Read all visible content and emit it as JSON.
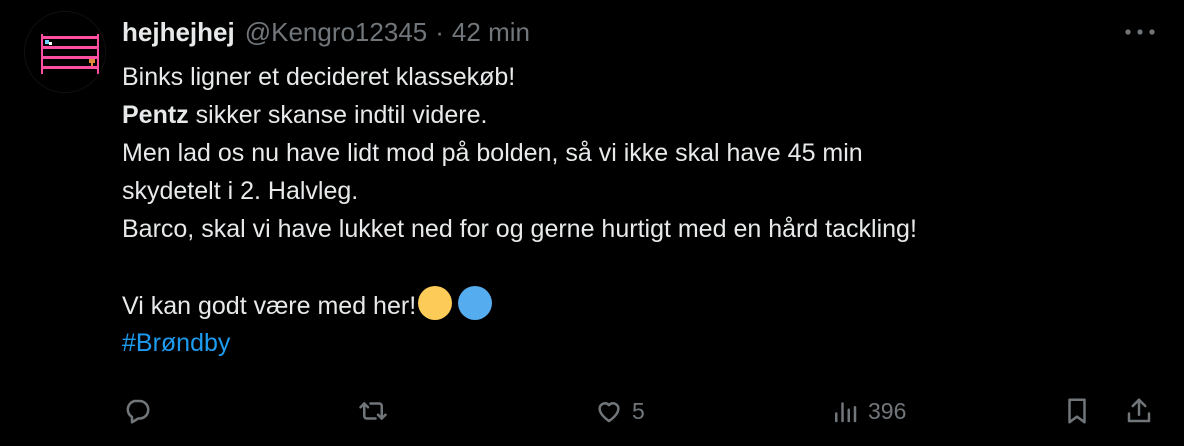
{
  "tweet": {
    "author": {
      "name": "hejhejhej",
      "handle": "@Kengro12345",
      "separator": "·",
      "time": "42 min"
    },
    "lines": [
      {
        "bold": "",
        "text": "Binks ligner et decideret klassekøb!"
      },
      {
        "bold": "Pentz",
        "text": " sikker skanse indtil videre."
      },
      {
        "bold": "",
        "text": "Men lad os nu have lidt mod på bolden, så vi ikke skal have 45 min"
      },
      {
        "bold": "",
        "text": "skydetelt i 2. Halvleg."
      },
      {
        "bold": "",
        "text": "Barco, skal vi have lukket ned for og gerne hurtigt med en hård tackling!"
      }
    ],
    "closing": "Vi kan godt være med her!",
    "emojis": [
      {
        "name": "yellow-circle",
        "color": "#fdcb58"
      },
      {
        "name": "blue-circle",
        "color": "#55acee"
      }
    ],
    "hashtag": "#Brøndby"
  },
  "actions": {
    "reply": {
      "icon": "reply-icon",
      "count": ""
    },
    "repost": {
      "icon": "repost-icon",
      "count": ""
    },
    "like": {
      "icon": "heart-icon",
      "count": "5"
    },
    "views": {
      "icon": "views-icon",
      "count": "396"
    },
    "bookmark": {
      "icon": "bookmark-icon"
    },
    "share": {
      "icon": "share-icon"
    }
  }
}
